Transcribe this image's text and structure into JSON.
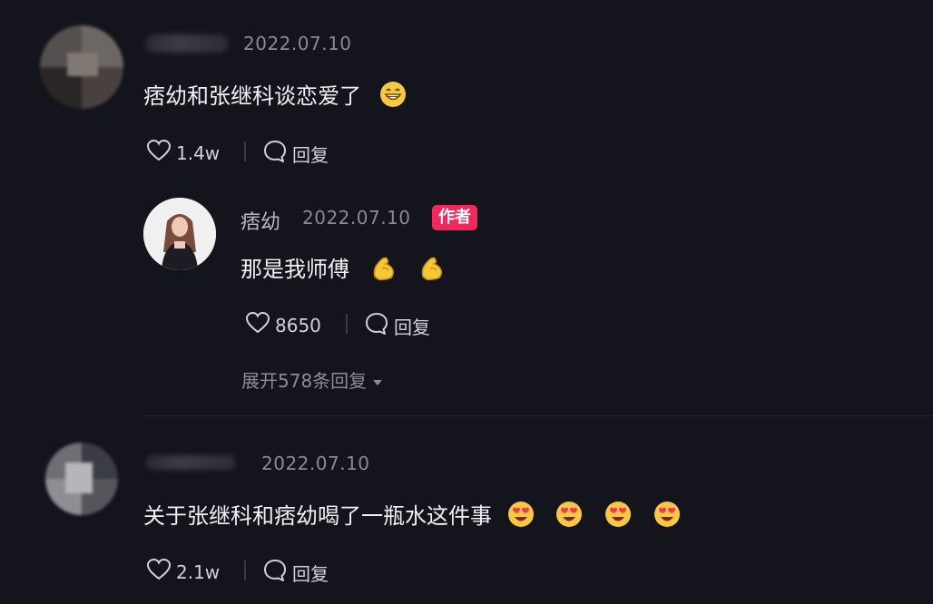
{
  "comments": [
    {
      "date": "2022.07.10",
      "text": "痞幼和张继科谈恋爱了",
      "emoji": [
        "grinning-face"
      ],
      "likes": "1.4w",
      "reply_label": "回复",
      "reply": {
        "username": "痞幼",
        "date": "2022.07.10",
        "badge": "作者",
        "text": "那是我师傅",
        "emoji": [
          "flexed-arm",
          "flexed-arm"
        ],
        "likes": "8650",
        "reply_label": "回复",
        "expand_label": "展开578条回复"
      }
    },
    {
      "date": "2022.07.10",
      "text": "关于张继科和痞幼喝了一瓶水这件事",
      "emoji": [
        "heart-eyes-face",
        "heart-eyes-face",
        "heart-eyes-face",
        "heart-eyes-face"
      ],
      "likes": "2.1w",
      "reply_label": "回复"
    }
  ],
  "colors": {
    "background": "#14141c",
    "badge": "#f5275a",
    "date": "#8a8a95",
    "text": "#f1f1f4"
  }
}
